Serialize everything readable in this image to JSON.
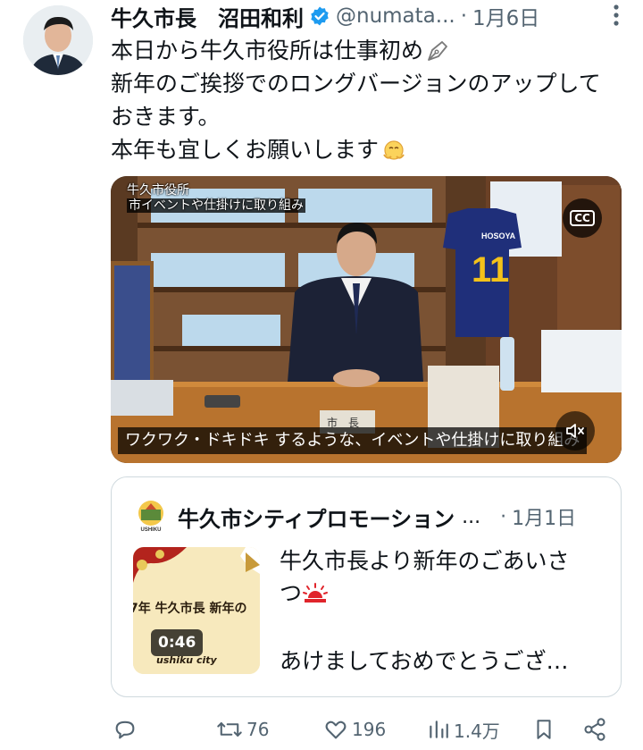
{
  "tweet": {
    "author_name": "牛久市長　沼田和利",
    "handle": "@numata...",
    "separator": "·",
    "date": "1月6日",
    "body_lines": [
      "本日から牛久市役所は仕事初め",
      "新年のご挨拶でのロングバージョンのアップして",
      "おきます。",
      "本年も宜しくお願いします"
    ]
  },
  "video": {
    "top_caption_line1": "牛久市役所",
    "top_caption_line2": "市イベントや仕掛けに取り組み",
    "subtitle": "ワクワク・ドキドキ するような、イベントや仕掛けに取り組み",
    "cc_label": "CC",
    "jersey_name": "HOSOYA",
    "jersey_number": "11",
    "nameplate": "市　長"
  },
  "quote": {
    "author_name": "牛久市シティプロモーション",
    "ellipsis": "...",
    "separator": "·",
    "date": "1月1日",
    "text_lines": [
      "牛久市長より新年のごあいさ",
      "つ",
      "あけましておめでとうござ…"
    ],
    "thumb_title": "7年 牛久市長 新年の",
    "thumb_duration": "0:46",
    "thumb_brand": "ushiku city",
    "avatar_label": "USHIKU"
  },
  "actions": {
    "retweets": "76",
    "likes": "196",
    "views": "1.4万"
  },
  "colors": {
    "text": "#0f1419",
    "secondary": "#536471",
    "verified": "#1d9bf0",
    "border": "#cfd9de"
  },
  "icons": [
    "verified-badge-icon",
    "more-icon",
    "pen-nib-icon",
    "face-emoji-icon",
    "cc-icon",
    "mute-icon",
    "sunrise-emoji-icon",
    "reply-icon",
    "retweet-icon",
    "like-icon",
    "views-icon",
    "bookmark-icon",
    "share-icon"
  ]
}
